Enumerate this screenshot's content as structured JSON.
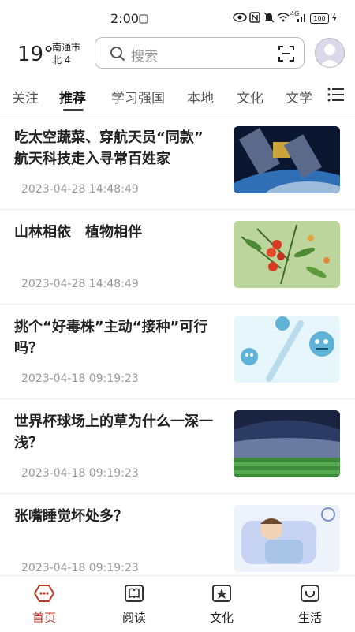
{
  "status": {
    "time": "2:00",
    "network": "4G",
    "battery": "100"
  },
  "header": {
    "temperature": "19°",
    "city": "南通市",
    "wind": "北 4",
    "search_placeholder": "搜索",
    "search_icon": "search-icon",
    "scan_icon": "scan-icon"
  },
  "tabs": [
    {
      "label": "关注"
    },
    {
      "label": "推荐",
      "active": true
    },
    {
      "label": "学习强国"
    },
    {
      "label": "本地"
    },
    {
      "label": "文化"
    },
    {
      "label": "文学"
    }
  ],
  "feed": [
    {
      "title": "吃太空蔬菜、穿航天员“同款” 航天科技走入寻常百姓家",
      "date": "2023-04-28 14:48:49"
    },
    {
      "title": "山林相依　植物相伴",
      "date": "2023-04-28 14:48:49"
    },
    {
      "title": "挑个“好毒株”主动“接种”可行吗？",
      "date": "2023-04-18 09:19:23"
    },
    {
      "title": "世界杯球场上的草为什么一深一浅？",
      "date": "2023-04-18 09:19:23"
    },
    {
      "title": "张嘴睡觉坏处多？",
      "date": "2023-04-18 09:19:23"
    }
  ],
  "bottom_nav": [
    {
      "label": "首页",
      "icon": "home-icon",
      "active": true
    },
    {
      "label": "阅读",
      "icon": "book-icon"
    },
    {
      "label": "文化",
      "icon": "culture-icon"
    },
    {
      "label": "生活",
      "icon": "life-icon"
    }
  ],
  "colors": {
    "accent": "#c0392b"
  }
}
